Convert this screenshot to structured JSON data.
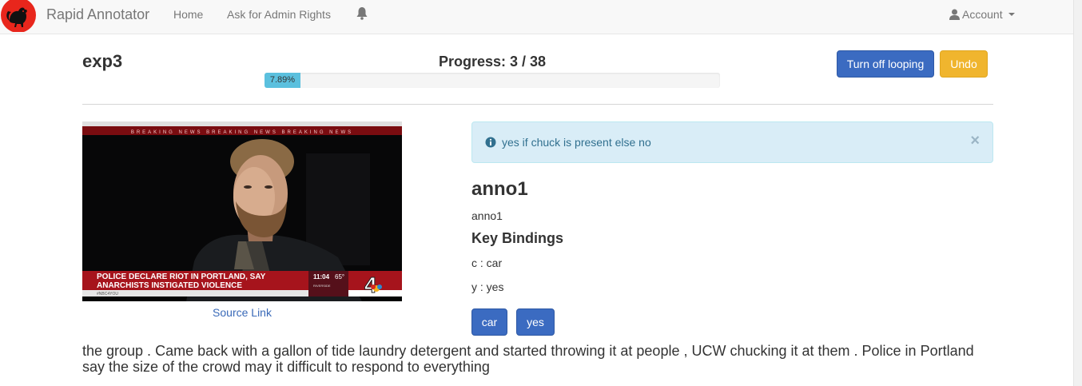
{
  "navbar": {
    "brand": "Rapid Annotator",
    "links": [
      "Home",
      "Ask for Admin Rights"
    ],
    "notifications_icon": "bell-icon",
    "account_label": "Account",
    "account_icon": "user-icon"
  },
  "experiment": {
    "name": "exp3",
    "progress_label": "Progress: 3 / 38",
    "progress_percent_text": "7.89%",
    "progress_fraction": 0.0789
  },
  "actions": {
    "looping_button": "Turn off looping",
    "undo_button": "Undo"
  },
  "media": {
    "banner_text": "BREAKING NEWS  BREAKING NEWS  BREAKING NEWS",
    "lower_third_line1": "POLICE DECLARE RIOT IN PORTLAND, SAY",
    "lower_third_line2": "ANARCHISTS INSTIGATED VIOLENCE",
    "hashtag": "#NBC4YOU",
    "time": "11:04",
    "temperature": "65°",
    "location": "RIVERSIDE",
    "channel_number": "4",
    "source_link": "Source Link"
  },
  "instruction": {
    "text": "yes if chuck is present else no",
    "close": "×",
    "icon": "info-circle-icon"
  },
  "annotation": {
    "title": "anno1",
    "subtitle": "anno1",
    "key_bindings_title": "Key Bindings",
    "key_bindings": [
      "c : car",
      "y : yes"
    ],
    "buttons": [
      "car",
      "yes"
    ]
  },
  "transcript": {
    "text": "the group . Came back with a gallon of tide laundry detergent and started throwing it at people , UCW chucking it at them . Police in Portland say the size of the crowd may it difficult to respond to everything"
  },
  "colors": {
    "primary": "#3b6bc1",
    "warning": "#f0b52e",
    "info": "#5bc0de",
    "alert_bg": "#d9edf7",
    "news_red": "#a6141c"
  }
}
